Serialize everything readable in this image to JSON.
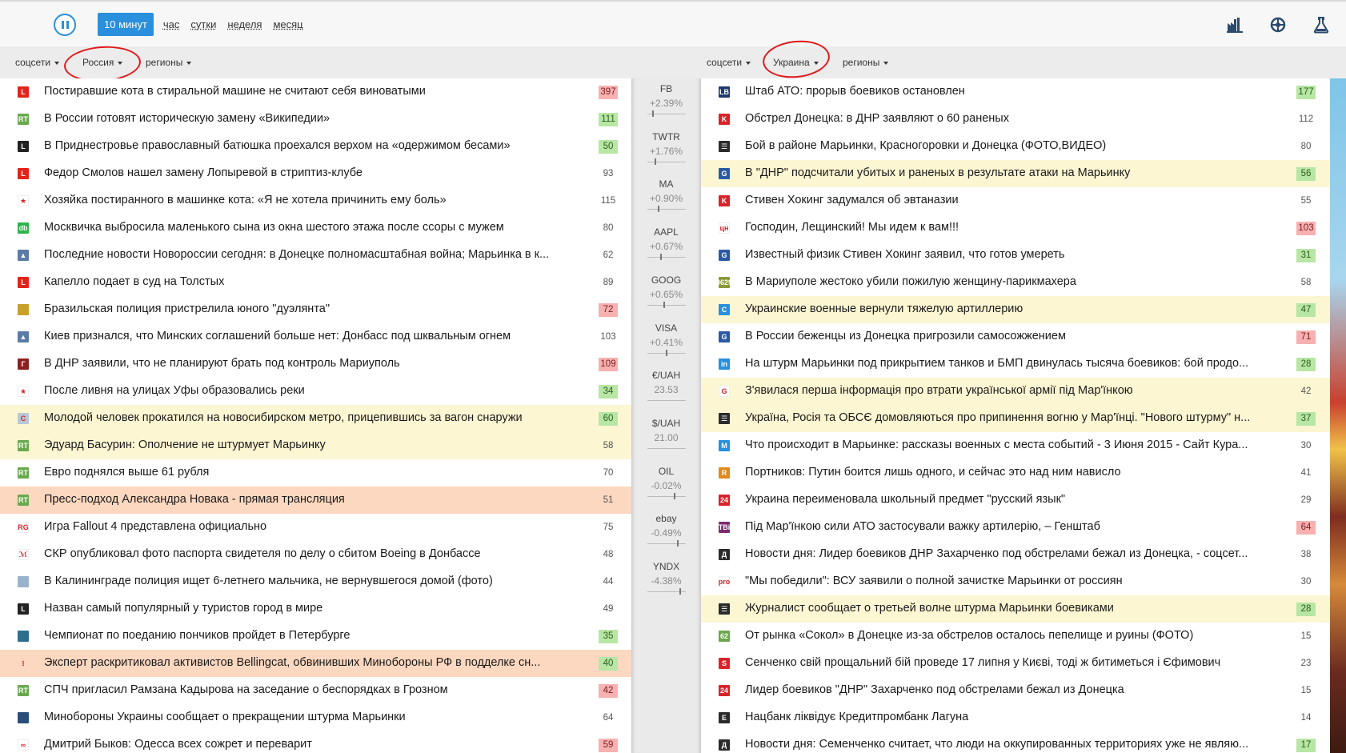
{
  "periods": [
    {
      "label": "10 минут",
      "active": true
    },
    {
      "label": "час",
      "active": false
    },
    {
      "label": "сутки",
      "active": false
    },
    {
      "label": "неделя",
      "active": false
    },
    {
      "label": "месяц",
      "active": false
    }
  ],
  "top_icons": [
    "factory-icon",
    "spinner-icon",
    "flask-icon"
  ],
  "left_filters": [
    "соцсети",
    "Россия",
    "регионы"
  ],
  "right_filters": [
    "соцсети",
    "Украина",
    "регионы"
  ],
  "colors": {
    "accent": "#2a8fdc",
    "highlight_yellow": "#fdf6d3",
    "highlight_orange": "#fdd8c0",
    "count_green": "#b8e6a4",
    "count_red": "#f7b1b1",
    "annotation": "#e01a1a"
  },
  "tickers": [
    {
      "name": "FB",
      "value": "+2.39%"
    },
    {
      "name": "TWTR",
      "value": "+1.76%"
    },
    {
      "name": "MA",
      "value": "+0.90%"
    },
    {
      "name": "AAPL",
      "value": "+0.67%"
    },
    {
      "name": "GOOG",
      "value": "+0.65%"
    },
    {
      "name": "VISA",
      "value": "+0.41%"
    },
    {
      "name": "€/UAH",
      "value": "23.53"
    },
    {
      "name": "$/UAH",
      "value": "21.00"
    },
    {
      "name": "OIL",
      "value": "-0.02%"
    },
    {
      "name": "ebay",
      "value": "-0.49%"
    },
    {
      "name": "YNDX",
      "value": "-4.38%"
    }
  ],
  "left_news": [
    {
      "title": "Постиравшие кота в стиральной машине не считают себя виноватыми",
      "count": "397",
      "count_color": "red",
      "highlight": "",
      "icon": "L",
      "icon_color": "#e2231a"
    },
    {
      "title": "В России готовят историческую замену «Википедии»",
      "count": "111",
      "count_color": "green",
      "highlight": "",
      "icon": "RT",
      "icon_color": "#6aa84f"
    },
    {
      "title": "В Приднестровье православный батюшка проехался верхом на «одержимом бесами»",
      "count": "50",
      "count_color": "green",
      "highlight": "",
      "icon": "L",
      "icon_color": "#222222"
    },
    {
      "title": "Федор Смолов нашел замену Лопыревой в стриптиз-клубе",
      "count": "93",
      "count_color": "",
      "highlight": "",
      "icon": "L",
      "icon_color": "#e2231a"
    },
    {
      "title": "Хозяйка постиранного в машинке кота: «Я не хотела причинить ему боль»",
      "count": "115",
      "count_color": "",
      "highlight": "",
      "icon": "★",
      "icon_color": "#ffffff"
    },
    {
      "title": "Москвичка выбросила маленького сына из окна шестого этажа после ссоры с мужем",
      "count": "80",
      "count_color": "",
      "highlight": "",
      "icon": "db",
      "icon_color": "#2cb34a"
    },
    {
      "title": "Последние новости Новороссии сегодня: в Донецке полномасштабная война; Марьинка в к...",
      "count": "62",
      "count_color": "",
      "highlight": "",
      "icon": "▲",
      "icon_color": "#5b7aa6"
    },
    {
      "title": "Капелло подает в суд на Толстых",
      "count": "89",
      "count_color": "",
      "highlight": "",
      "icon": "L",
      "icon_color": "#e2231a"
    },
    {
      "title": "Бразильская полиция пристрелила юного \"дуэлянта\"",
      "count": "72",
      "count_color": "red",
      "highlight": "",
      "icon": "",
      "icon_color": "#c8a02a"
    },
    {
      "title": "Киев признался, что Минских соглашений больше нет: Донбасс под шквальным огнем",
      "count": "103",
      "count_color": "",
      "highlight": "",
      "icon": "▲",
      "icon_color": "#5b7aa6"
    },
    {
      "title": "В ДНР заявили, что не планируют брать под контроль Мариуполь",
      "count": "109",
      "count_color": "red",
      "highlight": "",
      "icon": "Г",
      "icon_color": "#8b1f1f"
    },
    {
      "title": "После ливня на улицах Уфы образовались реки",
      "count": "34",
      "count_color": "green",
      "highlight": "",
      "icon": "★",
      "icon_color": "#ffffff"
    },
    {
      "title": "Молодой человек прокатился на новосибирском метро, прицепившись за вагон снаружи",
      "count": "60",
      "count_color": "green",
      "highlight": "yellow",
      "icon": "C",
      "icon_color": "#b9c7d6"
    },
    {
      "title": "Эдуард Басурин: Ополчение не штурмует Марьинку",
      "count": "58",
      "count_color": "",
      "highlight": "yellow",
      "icon": "RT",
      "icon_color": "#6aa84f"
    },
    {
      "title": "Евро поднялся выше 61 рубля",
      "count": "70",
      "count_color": "",
      "highlight": "",
      "icon": "RT",
      "icon_color": "#6aa84f"
    },
    {
      "title": "Пресс-подход Александра Новака - прямая трансляция",
      "count": "51",
      "count_color": "",
      "highlight": "orange",
      "icon": "RT",
      "icon_color": "#6aa84f"
    },
    {
      "title": "Игра Fallout 4 представлена официально",
      "count": "75",
      "count_color": "",
      "highlight": "",
      "icon": "RG",
      "icon_color": "#ffffff"
    },
    {
      "title": "СКР опубликовал фото паспорта свидетеля по делу о сбитом Boeing в Донбассе",
      "count": "48",
      "count_color": "",
      "highlight": "",
      "icon": "ℳ",
      "icon_color": "#ffffff"
    },
    {
      "title": "В Калининграде полиция ищет 6-летнего мальчика, не вернувшегося домой (фото)",
      "count": "44",
      "count_color": "",
      "highlight": "",
      "icon": "",
      "icon_color": "#9ab3cc"
    },
    {
      "title": "Назван самый популярный у туристов город в мире",
      "count": "49",
      "count_color": "",
      "highlight": "",
      "icon": "L",
      "icon_color": "#222222"
    },
    {
      "title": "Чемпионат по поеданию пончиков пройдет в Петербурге",
      "count": "35",
      "count_color": "green",
      "highlight": "",
      "icon": "",
      "icon_color": "#2d6e8e"
    },
    {
      "title": "Эксперт раскритиковал активистов Bellingcat, обвинивших Минобороны РФ в подделке сн...",
      "count": "40",
      "count_color": "green",
      "highlight": "orange",
      "icon": "⁝",
      "icon_color": "#fdd8c0"
    },
    {
      "title": "СПЧ пригласил Рамзана Кадырова на заседание о беспорядках в Грозном",
      "count": "42",
      "count_color": "red",
      "highlight": "",
      "icon": "RT",
      "icon_color": "#6aa84f"
    },
    {
      "title": "Минобороны Украины сообщает о прекращении штурма Марьинки",
      "count": "64",
      "count_color": "",
      "highlight": "",
      "icon": "",
      "icon_color": "#2a4d7a"
    },
    {
      "title": "Дмитрий Быков: Одесса всех сожрет и переварит",
      "count": "59",
      "count_color": "red",
      "highlight": "",
      "icon": "∞",
      "icon_color": "#ffffff"
    }
  ],
  "right_news": [
    {
      "title": "Штаб АТО: прорыв боевиков остановлен",
      "count": "177",
      "count_color": "green",
      "highlight": "",
      "icon": "LB",
      "icon_color": "#1f3a6e"
    },
    {
      "title": "Обстрел Донецка: в ДНР заявляют о 60 раненых",
      "count": "112",
      "count_color": "",
      "highlight": "",
      "icon": "K",
      "icon_color": "#d8232a"
    },
    {
      "title": "Бой в районе Марьинки, Красногоровки и Донецка (ФОТО,ВИДЕО)",
      "count": "80",
      "count_color": "",
      "highlight": "",
      "icon": "☰",
      "icon_color": "#2b2b2b"
    },
    {
      "title": "В \"ДНР\" подсчитали убитых и раненых в результате атаки на Марьинку",
      "count": "56",
      "count_color": "green",
      "highlight": "yellow",
      "icon": "G",
      "icon_color": "#2a5aa3"
    },
    {
      "title": "Стивен Хокинг задумался об эвтаназии",
      "count": "55",
      "count_color": "",
      "highlight": "",
      "icon": "K",
      "icon_color": "#d8232a"
    },
    {
      "title": "Господин, Лещинский! Мы идем к вам!!!",
      "count": "103",
      "count_color": "red",
      "highlight": "",
      "icon": "цн",
      "icon_color": "#ffffff"
    },
    {
      "title": "Известный физик Стивен Хокинг заявил, что готов умереть",
      "count": "31",
      "count_color": "green",
      "highlight": "",
      "icon": "G",
      "icon_color": "#2a5aa3"
    },
    {
      "title": "В Мариуполе жестоко убили пожилую женщину-парикмахера",
      "count": "58",
      "count_color": "",
      "highlight": "",
      "icon": "0629",
      "icon_color": "#8a9a3a"
    },
    {
      "title": "Украинские военные вернули тяжелую артиллерию",
      "count": "47",
      "count_color": "green",
      "highlight": "yellow",
      "icon": "C",
      "icon_color": "#2a8fdc"
    },
    {
      "title": "В России беженцы из Донецка пригрозили самосожжением",
      "count": "71",
      "count_color": "red",
      "highlight": "",
      "icon": "G",
      "icon_color": "#2a5aa3"
    },
    {
      "title": "На штурм Марьинки под прикрытием танков и БМП двинулась тысяча боевиков: бой продо...",
      "count": "28",
      "count_color": "green",
      "highlight": "",
      "icon": "in",
      "icon_color": "#2a8fdc"
    },
    {
      "title": "З'явилася перша інформація про втрати української армії під Мар'їнкою",
      "count": "42",
      "count_color": "",
      "highlight": "yellow",
      "icon": "G",
      "icon_color": "#ffffff"
    },
    {
      "title": "Україна, Росія та ОБСЄ домовляються про припинення вогню у Мар'їнці. \"Нового штурму\" н...",
      "count": "37",
      "count_color": "green",
      "highlight": "yellow",
      "icon": "☰",
      "icon_color": "#2b2b2b"
    },
    {
      "title": "Что происходит в Марьинке: рассказы военных с места событий - 3 Июня 2015 - Сайт Кура...",
      "count": "30",
      "count_color": "",
      "highlight": "",
      "icon": "M",
      "icon_color": "#2a8fdc"
    },
    {
      "title": "Портников: Путин боится лишь одного, и сейчас это над ним нависло",
      "count": "41",
      "count_color": "",
      "highlight": "",
      "icon": "R",
      "icon_color": "#e08a1f"
    },
    {
      "title": "Украина переименовала школьный предмет \"русский язык\"",
      "count": "29",
      "count_color": "",
      "highlight": "",
      "icon": "24",
      "icon_color": "#d8232a"
    },
    {
      "title": "Під Мар'їнкою сили АТО застосували важку артилерію, – Генштаб",
      "count": "64",
      "count_color": "red",
      "highlight": "",
      "icon": "TBi",
      "icon_color": "#7a2a6e"
    },
    {
      "title": "Новости дня: Лидер боевиков ДНР Захарченко под обстрелами бежал из Донецка, - соцсет...",
      "count": "38",
      "count_color": "",
      "highlight": "",
      "icon": "Д",
      "icon_color": "#2b2b2b"
    },
    {
      "title": "\"Мы победили\": ВСУ заявили о полной зачистке Марьинки от россиян",
      "count": "30",
      "count_color": "",
      "highlight": "",
      "icon": "pro",
      "icon_color": "#ffffff"
    },
    {
      "title": "Журналист сообщает о третьей волне штурма Марьинки боевиками",
      "count": "28",
      "count_color": "green",
      "highlight": "yellow",
      "icon": "☰",
      "icon_color": "#2b2b2b"
    },
    {
      "title": "От рынка «Сокол» в Донецке из-за обстрелов осталось пепелище и руины (ФОТО)",
      "count": "15",
      "count_color": "",
      "highlight": "",
      "icon": "62",
      "icon_color": "#6aa84f"
    },
    {
      "title": "Сенченко свій прощальний бій проведе 17 липня у Києві, тоді ж битиметься і Єфимович",
      "count": "23",
      "count_color": "",
      "highlight": "",
      "icon": "S",
      "icon_color": "#d8232a"
    },
    {
      "title": "Лидер боевиков \"ДНР\" Захарченко под обстрелами бежал из Донецка",
      "count": "15",
      "count_color": "",
      "highlight": "",
      "icon": "24",
      "icon_color": "#d8232a"
    },
    {
      "title": "Нацбанк ліквідує Кредитпромбанк Лагуна",
      "count": "14",
      "count_color": "",
      "highlight": "",
      "icon": "E",
      "icon_color": "#2b2b2b"
    },
    {
      "title": "Новости дня: Семенченко считает, что люди на оккупированных территориях уже не являю...",
      "count": "17",
      "count_color": "green",
      "highlight": "",
      "icon": "Д",
      "icon_color": "#2b2b2b"
    }
  ]
}
